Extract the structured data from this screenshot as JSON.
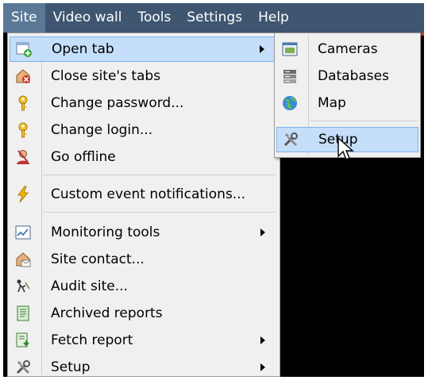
{
  "menubar": {
    "items": [
      "Site",
      "Video wall",
      "Tools",
      "Settings",
      "Help"
    ]
  },
  "site_menu": {
    "items": [
      {
        "label": "Open tab",
        "icon": "new-tab-icon",
        "submenu": true,
        "highlighted": true
      },
      {
        "label": "Close site's tabs",
        "icon": "house-close-icon"
      },
      {
        "label": "Change password...",
        "icon": "key-icon"
      },
      {
        "label": "Change login...",
        "icon": "key-icon"
      },
      {
        "label": "Go offline",
        "icon": "person-offline-icon"
      },
      {
        "label": "Custom event notifications...",
        "icon": "lightning-icon"
      },
      {
        "label": "Monitoring tools",
        "icon": "graph-icon",
        "submenu": true
      },
      {
        "label": "Site contact...",
        "icon": "house-contact-icon"
      },
      {
        "label": "Audit site...",
        "icon": "audit-icon"
      },
      {
        "label": "Archived reports",
        "icon": "report-book-icon"
      },
      {
        "label": "Fetch report",
        "icon": "fetch-report-icon",
        "submenu": true
      },
      {
        "label": "Setup",
        "icon": "tools-icon",
        "submenu": true
      }
    ]
  },
  "open_tab_submenu": {
    "items": [
      {
        "label": "Cameras",
        "icon": "camera-window-icon"
      },
      {
        "label": "Databases",
        "icon": "database-icon"
      },
      {
        "label": "Map",
        "icon": "globe-icon"
      },
      {
        "label": "Setup",
        "icon": "tools-icon",
        "highlighted": true
      }
    ]
  },
  "colors": {
    "menubar_bg": "#3e5670",
    "menubar_active": "#5b7896",
    "menu_bg": "#f0f0f0",
    "highlight_bg": "#c5defa",
    "highlight_border": "#7eb4ea"
  }
}
